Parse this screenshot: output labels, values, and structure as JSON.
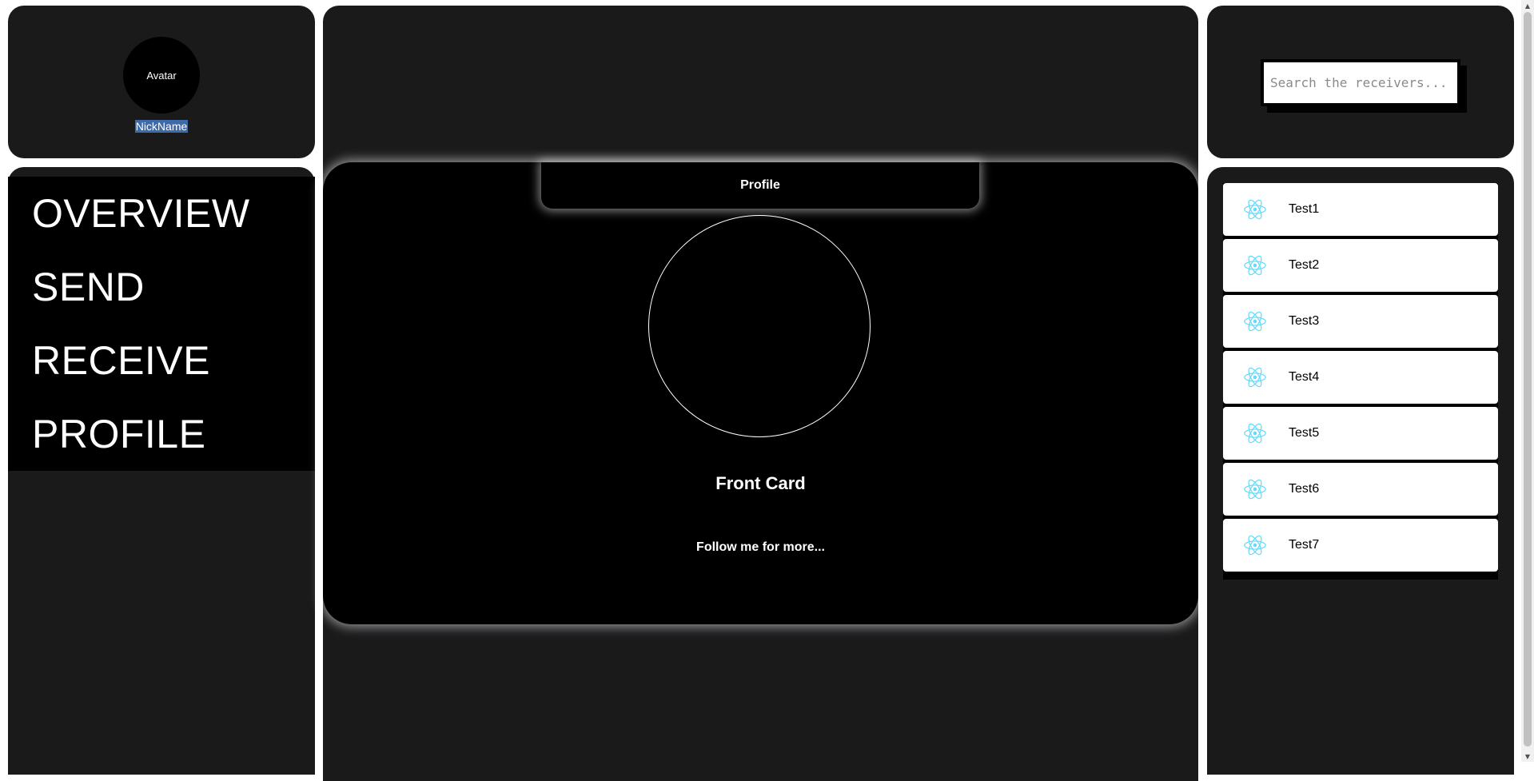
{
  "user": {
    "avatar_label": "Avatar",
    "nickname": "NickName"
  },
  "nav": {
    "items": [
      {
        "label": "OVERVIEW"
      },
      {
        "label": "SEND"
      },
      {
        "label": "RECEIVE"
      },
      {
        "label": "PROFILE"
      }
    ]
  },
  "card": {
    "tab_label": "Profile",
    "title": "Front Card",
    "subtitle": "Follow me for more..."
  },
  "search": {
    "placeholder": "Search the receivers..."
  },
  "receivers": {
    "icon": "react-atom-icon",
    "icon_color": "#61dafb",
    "items": [
      {
        "label": "Test1"
      },
      {
        "label": "Test2"
      },
      {
        "label": "Test3"
      },
      {
        "label": "Test4"
      },
      {
        "label": "Test5"
      },
      {
        "label": "Test6"
      },
      {
        "label": "Test7"
      }
    ]
  },
  "colors": {
    "panel": "#1a1a1b",
    "card": "#000000",
    "selection": "#3f6aa8"
  }
}
